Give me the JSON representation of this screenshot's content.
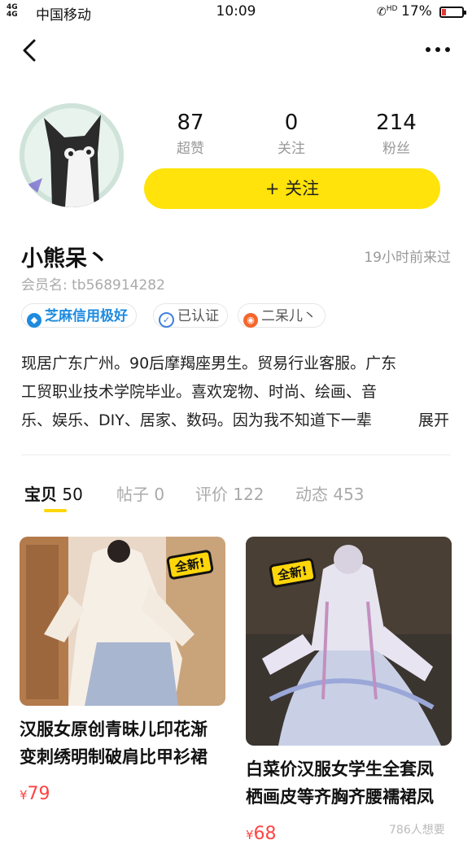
{
  "status": {
    "signal": "4G 4G",
    "carrier": "中国移动",
    "time": "10:09",
    "battery": "17%",
    "hd": "HD"
  },
  "nav": {
    "back_icon": "chevron-left-icon",
    "more_icon": "more-dots-icon"
  },
  "profile": {
    "stats": [
      {
        "value": "87",
        "label": "超赞"
      },
      {
        "value": "0",
        "label": "关注"
      },
      {
        "value": "214",
        "label": "粉丝"
      }
    ],
    "follow_label": "+ 关注",
    "name": "小熊呆丶",
    "last_seen": "19小时前来过",
    "member": "会员名: tb568914282",
    "badges": [
      {
        "label": "芝麻信用极好",
        "icon": "sesame-credit-icon",
        "color": "#1e8be0"
      },
      {
        "label": "已认证",
        "icon": "verified-icon",
        "color": "#3f7fe0"
      },
      {
        "label": "二呆儿丶",
        "icon": "weibo-icon",
        "color": "#f5662b"
      }
    ],
    "bio_lines": [
      "现居广东广州。90后摩羯座男生。贸易行业客服。广东",
      "工贸职业技术学院毕业。喜欢宠物、时尚、绘画、音",
      "乐、娱乐、DIY、居家、数码。因为我不知道下一辈"
    ],
    "expand_label": "展开"
  },
  "tabs": [
    {
      "name": "宝贝",
      "count": "50"
    },
    {
      "name": "帖子",
      "count": "0"
    },
    {
      "name": "评价",
      "count": "122"
    },
    {
      "name": "动态",
      "count": "453"
    }
  ],
  "products": [
    {
      "title_lines": [
        "汉服女原创青昧儿印花渐",
        "变刺绣明制破肩比甲衫裙"
      ],
      "currency": "¥",
      "price": "79",
      "tag": "全新!"
    },
    {
      "title_lines": [
        "白菜价汉服女学生全套凤",
        "栖画皮等齐胸齐腰襦裙凤"
      ],
      "currency": "¥",
      "price": "68",
      "tag": "全新!"
    }
  ],
  "watermark": "786人想要",
  "colors": {
    "accent": "#ffe30a",
    "price": "#ff4444"
  }
}
